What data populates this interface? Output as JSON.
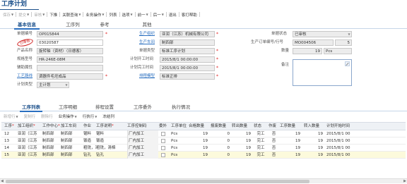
{
  "window": {
    "title": "工序计划"
  },
  "toolbar": {
    "items": [
      {
        "label": "保存",
        "enabled": false,
        "dropdown": true
      },
      {
        "label": "提交",
        "enabled": false,
        "dropdown": true
      },
      {
        "label": "审核",
        "enabled": false,
        "dropdown": true
      },
      {
        "label": "下推",
        "enabled": true,
        "dropdown": false
      },
      {
        "label": "关联查询",
        "enabled": true,
        "dropdown": true
      },
      {
        "label": "业务操作",
        "enabled": true,
        "dropdown": true
      },
      {
        "label": "列表",
        "enabled": true,
        "dropdown": false
      },
      {
        "label": "选项",
        "enabled": true,
        "dropdown": true
      },
      {
        "label": "前一",
        "enabled": true,
        "dropdown": true
      },
      {
        "label": "后一",
        "enabled": true,
        "dropdown": true
      },
      {
        "label": "退出",
        "enabled": true,
        "dropdown": false
      },
      {
        "label": "客打帮助",
        "enabled": true,
        "dropdown": false
      }
    ]
  },
  "main_tabs": [
    "基本信息",
    "工序列",
    "参考",
    "其他"
  ],
  "form": {
    "bill_no": {
      "label": "单据编号",
      "value": "OP015844"
    },
    "product_code": {
      "label": "产品编码",
      "value": "03020587"
    },
    "product_name": {
      "label": "产品名称",
      "value": "旋转轴（资材）（日德客）"
    },
    "spec": {
      "label": "规格型号",
      "value": "HR-246E-08M"
    },
    "aux_attr": {
      "label": "辅助属性",
      "value": ""
    },
    "route": {
      "label": "工艺路线",
      "value": "调器件毛坯成品"
    },
    "plan_type": {
      "label": "计划类型",
      "value": "主计划"
    },
    "prod_org": {
      "label": "生产组织",
      "value": "亚润（江苏）机械有限公司"
    },
    "prod_workshop": {
      "label": "生产车间",
      "value": "制四部"
    },
    "bill_type": {
      "label": "单据类型",
      "value": "标准工序计划"
    },
    "plan_start": {
      "label": "计划开工时间",
      "value": "2015/8/1 00:00:00"
    },
    "plan_finish": {
      "label": "计划完工时间",
      "value": "2015/8/1 00:00:00"
    },
    "schedule_mode": {
      "label": "排程模型",
      "value": "标准正排"
    },
    "status": {
      "label": "单据状态",
      "value": "已审核"
    },
    "order_no": {
      "label": "生产订单编号/行号",
      "value": "MO004506",
      "line": "5"
    },
    "qty": {
      "label": "数量",
      "value": "19",
      "unit": "Pcs"
    },
    "remarks": {
      "label": "备注",
      "value": ""
    },
    "stamp_text": "已审核"
  },
  "detail_tabs": [
    "工序列表",
    "工序明细",
    "排程设置",
    "工序委外",
    "执行情况"
  ],
  "subtoolbar": [
    {
      "label": "新增行",
      "enabled": false,
      "dropdown": true
    },
    {
      "label": "复制行",
      "enabled": false,
      "dropdown": false
    },
    {
      "label": "删除行",
      "enabled": false,
      "dropdown": false
    },
    {
      "label": "业务操作",
      "enabled": true,
      "dropdown": true
    },
    {
      "label": "行执行",
      "enabled": true,
      "dropdown": true
    },
    {
      "label": "冻结列",
      "enabled": true,
      "dropdown": false
    }
  ],
  "grid": {
    "columns": [
      {
        "label": "工序",
        "required": true
      },
      {
        "label": "加工组织",
        "required": true
      },
      {
        "label": "工作中心",
        "required": true
      },
      {
        "label": "加工车间",
        "required": false
      },
      {
        "label": "作业",
        "required": false
      },
      {
        "label": "工序说明",
        "required": true
      },
      {
        "label": "工序控制码",
        "required": false
      },
      {
        "label": "委外",
        "required": false
      },
      {
        "label": "工序单位",
        "required": false
      },
      {
        "label": "合格数量",
        "required": false
      },
      {
        "label": "报废数量",
        "required": false
      },
      {
        "label": "转出数量",
        "required": false
      },
      {
        "label": "状态",
        "required": false
      },
      {
        "label": "作废",
        "required": false
      },
      {
        "label": "工序数量",
        "required": false
      },
      {
        "label": "转入数量",
        "required": false
      },
      {
        "label": "计划开始时间",
        "required": false
      }
    ],
    "rows": [
      {
        "seq": "12",
        "org": "亚润（江苏",
        "wc": "制四部",
        "ws": "制四部",
        "op": "锯料",
        "desc": "锯料",
        "ctrl": "厂内加工",
        "outsource": false,
        "unit": "Pcs",
        "qualified": "19",
        "scrap": "0",
        "out": "19",
        "status": "完工",
        "void": "否",
        "op_qty": "19",
        "in_qty": "19",
        "plan_start": "2015/8/1 00"
      },
      {
        "seq": "13",
        "org": "亚润（江苏",
        "wc": "制四部",
        "ws": "制四部",
        "op": "锻造",
        "desc": "锻造",
        "ctrl": "厂内加工",
        "outsource": false,
        "unit": "Pcs",
        "qualified": "19",
        "scrap": "0",
        "out": "19",
        "status": "完工",
        "void": "否",
        "op_qty": "19",
        "in_qty": "19",
        "plan_start": "2015/8/1 00"
      },
      {
        "seq": "14",
        "org": "亚润（江苏",
        "wc": "制四部",
        "ws": "制四部",
        "op": "粗铣，清棉",
        "desc": "粗铣，清棉",
        "ctrl": "厂内加工",
        "outsource": false,
        "unit": "Pcs",
        "qualified": "19",
        "scrap": "0",
        "out": "19",
        "status": "完工",
        "void": "否",
        "op_qty": "19",
        "in_qty": "19",
        "plan_start": "2015/8/1 00"
      },
      {
        "seq": "15",
        "org": "亚润（江苏",
        "wc": "制四部",
        "ws": "制四部",
        "op": "钻孔",
        "desc": "钻孔",
        "ctrl": "厂内加工",
        "outsource": false,
        "unit": "Pcs",
        "qualified": "19",
        "scrap": "0",
        "out": "19",
        "status": "完工",
        "void": "否",
        "op_qty": "19",
        "in_qty": "19",
        "plan_start": "2015/8/1 00"
      }
    ]
  }
}
